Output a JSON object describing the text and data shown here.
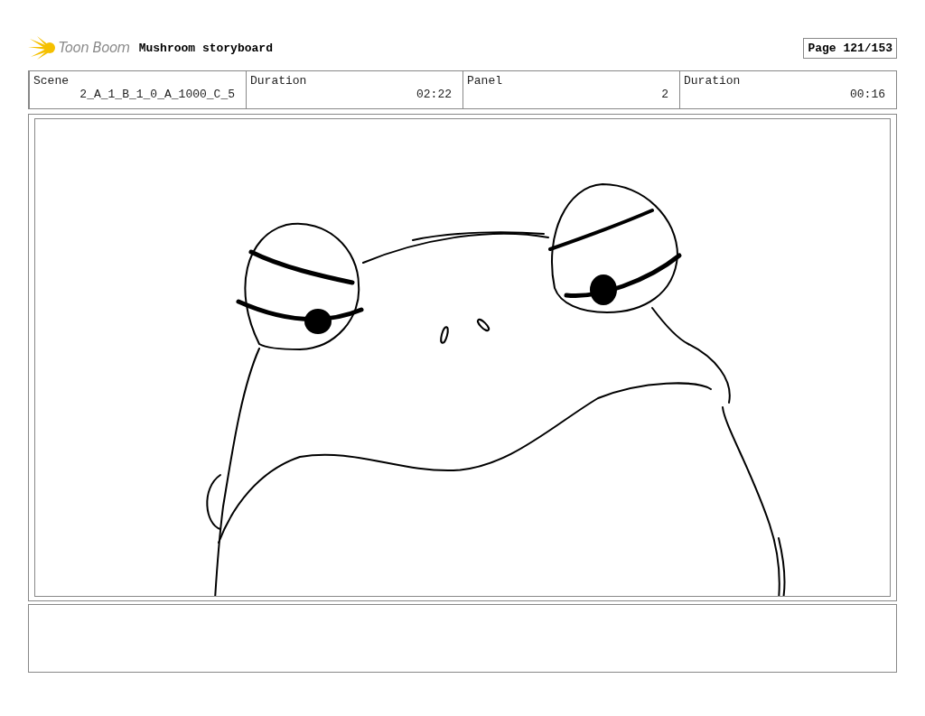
{
  "header": {
    "logo": "Toon Boom",
    "title": "Mushroom storyboard",
    "page": "Page 121/153"
  },
  "info": [
    {
      "label": "Scene",
      "value": "2_A_1_B_1_0_A_1000_C_5"
    },
    {
      "label": "Duration",
      "value": "02:22"
    },
    {
      "label": "Panel",
      "value": "2"
    },
    {
      "label": "Duration",
      "value": "00:16"
    }
  ]
}
